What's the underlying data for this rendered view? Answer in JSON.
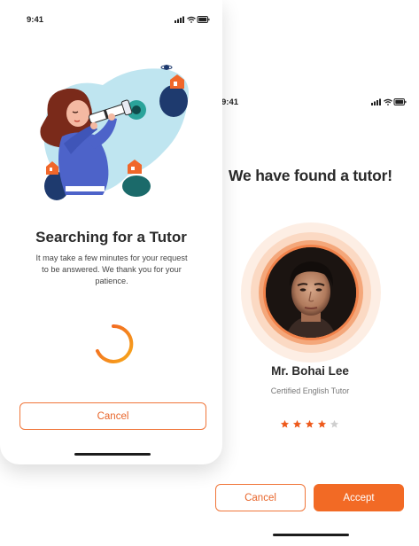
{
  "searching_screen": {
    "status_time": "9:41",
    "title": "Searching for a Tutor",
    "description": "It may take a few minutes for your request to be answered. We thank you for your patience.",
    "cancel_label": "Cancel"
  },
  "found_screen": {
    "status_time": "9:41",
    "title": "We have found a tutor!",
    "tutor_name": "Mr. Bohai Lee",
    "tutor_role": "Certified English Tutor",
    "rating": 4,
    "rating_max": 5,
    "cancel_label": "Cancel",
    "accept_label": "Accept"
  },
  "colors": {
    "accent": "#f26a25",
    "star_filled": "#ee5a1c",
    "star_empty": "#cfcfcf",
    "illustration_bg": "#bfe5f0"
  },
  "icons": [
    "signal-icon",
    "wifi-icon",
    "battery-icon",
    "star-icon"
  ]
}
